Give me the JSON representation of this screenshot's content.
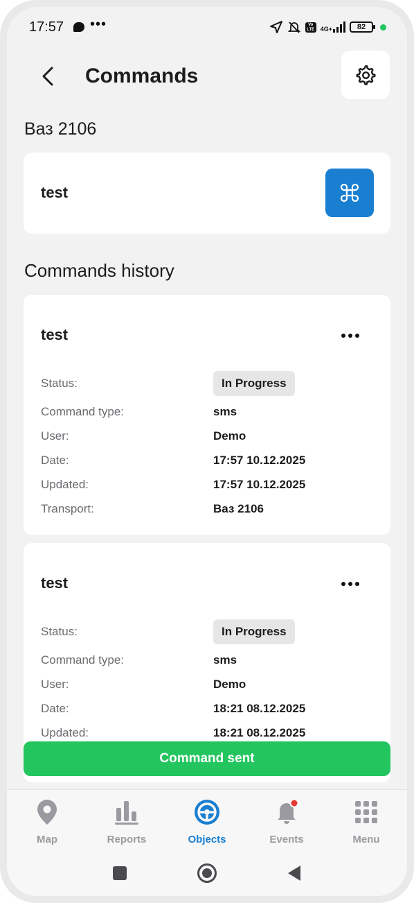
{
  "status_bar": {
    "time": "17:57",
    "dots": "•••",
    "network": "4G+",
    "battery": "82"
  },
  "header": {
    "title": "Commands",
    "back_icon": "chevron-left-icon",
    "settings_icon": "gear-icon"
  },
  "vehicle": {
    "name": "Ваз 2106"
  },
  "command": {
    "name": "test",
    "icon": "command-icon"
  },
  "history": {
    "title": "Commands history",
    "items": [
      {
        "title": "test",
        "rows": [
          {
            "label": "Status:",
            "value": "In Progress"
          },
          {
            "label": "Command type:",
            "value": "sms"
          },
          {
            "label": "User:",
            "value": "Demo"
          },
          {
            "label": "Date:",
            "value": "17:57 10.12.2025"
          },
          {
            "label": "Updated:",
            "value": "17:57 10.12.2025"
          },
          {
            "label": "Transport:",
            "value": "Ваз 2106"
          }
        ]
      },
      {
        "title": "test",
        "rows": [
          {
            "label": "Status:",
            "value": "In Progress"
          },
          {
            "label": "Command type:",
            "value": "sms"
          },
          {
            "label": "User:",
            "value": "Demo"
          },
          {
            "label": "Date:",
            "value": "18:21 08.12.2025"
          },
          {
            "label": "Updated:",
            "value": "18:21 08.12.2025"
          }
        ]
      }
    ]
  },
  "toast": {
    "message": "Command sent",
    "color": "#22c55e"
  },
  "bottom_nav": {
    "items": [
      {
        "label": "Map",
        "icon": "map-pin-icon"
      },
      {
        "label": "Reports",
        "icon": "bar-chart-icon"
      },
      {
        "label": "Objects",
        "icon": "steering-wheel-icon",
        "active": true
      },
      {
        "label": "Events",
        "icon": "bell-icon",
        "badge": true
      },
      {
        "label": "Menu",
        "icon": "grid-icon"
      }
    ]
  },
  "colors": {
    "accent": "#1a7fd1",
    "success": "#22c55e",
    "badge": "#e53935"
  }
}
